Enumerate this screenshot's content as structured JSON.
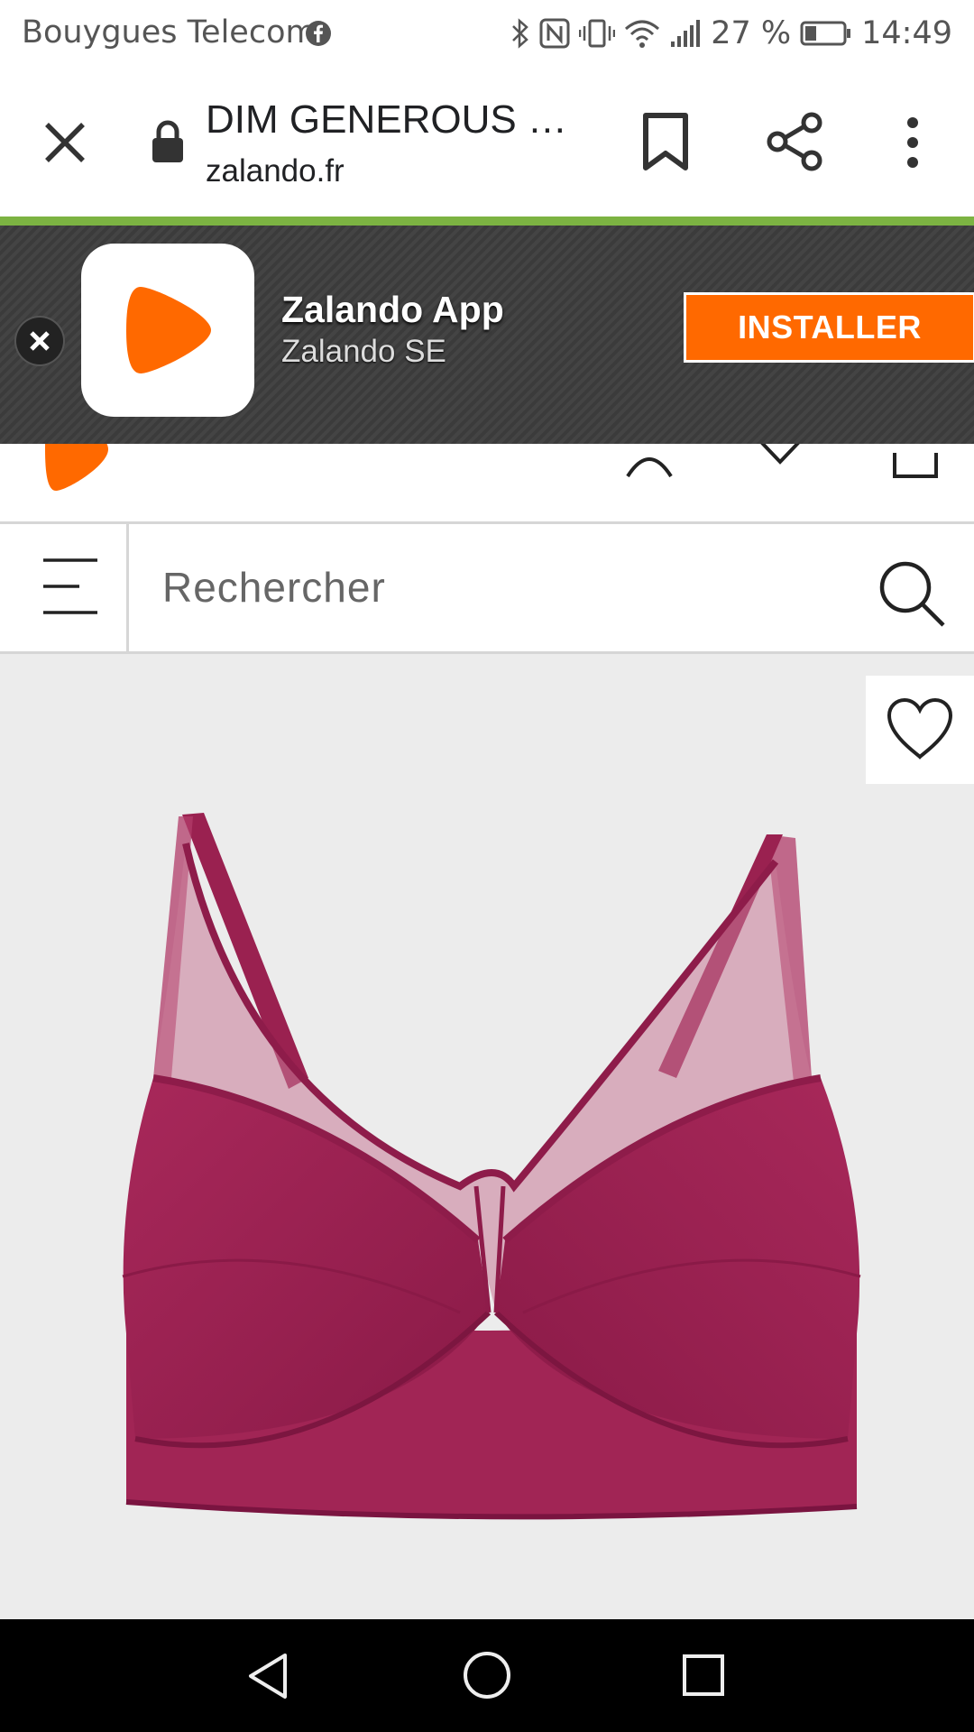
{
  "status_bar": {
    "carrier": "Bouygues Telecom",
    "battery_percent": "27 %",
    "time": "14:49"
  },
  "browser": {
    "page_title": "DIM GENEROUS …",
    "url": "zalando.fr"
  },
  "app_banner": {
    "app_name": "Zalando App",
    "vendor": "Zalando SE",
    "install_label": "INSTALLER",
    "brand_color": "#ff6900"
  },
  "site": {
    "search_placeholder": "Rechercher"
  },
  "product": {
    "color": "#9c1f4f"
  }
}
